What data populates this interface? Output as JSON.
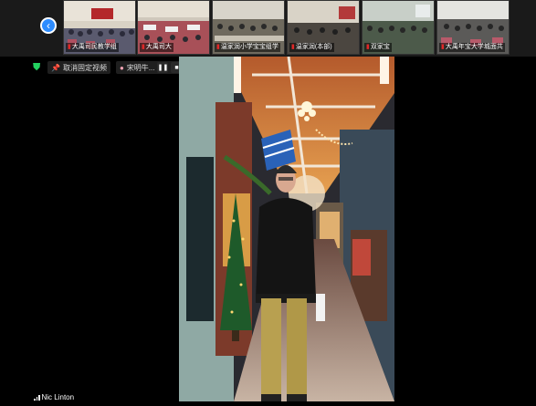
{
  "filmstrip": {
    "participants": [
      {
        "label": "大禹司民教学组",
        "muted": true
      },
      {
        "label": "大禹司大",
        "muted": true
      },
      {
        "label": "温家润小学宝宝组学",
        "muted": true
      },
      {
        "label": "温家润(本部)",
        "muted": true
      },
      {
        "label": "双家宝",
        "muted": true
      },
      {
        "label": "大禹年宝大学城面共",
        "muted": true
      }
    ]
  },
  "toolbar": {
    "pin_label": "取消固定视频",
    "pin_name": "宋明牛..."
  },
  "main_video": {
    "speaker_name": "Nic Linton"
  },
  "colors": {
    "accent": "#2d8cff",
    "shield": "#23d160",
    "muted": "#e02828"
  }
}
